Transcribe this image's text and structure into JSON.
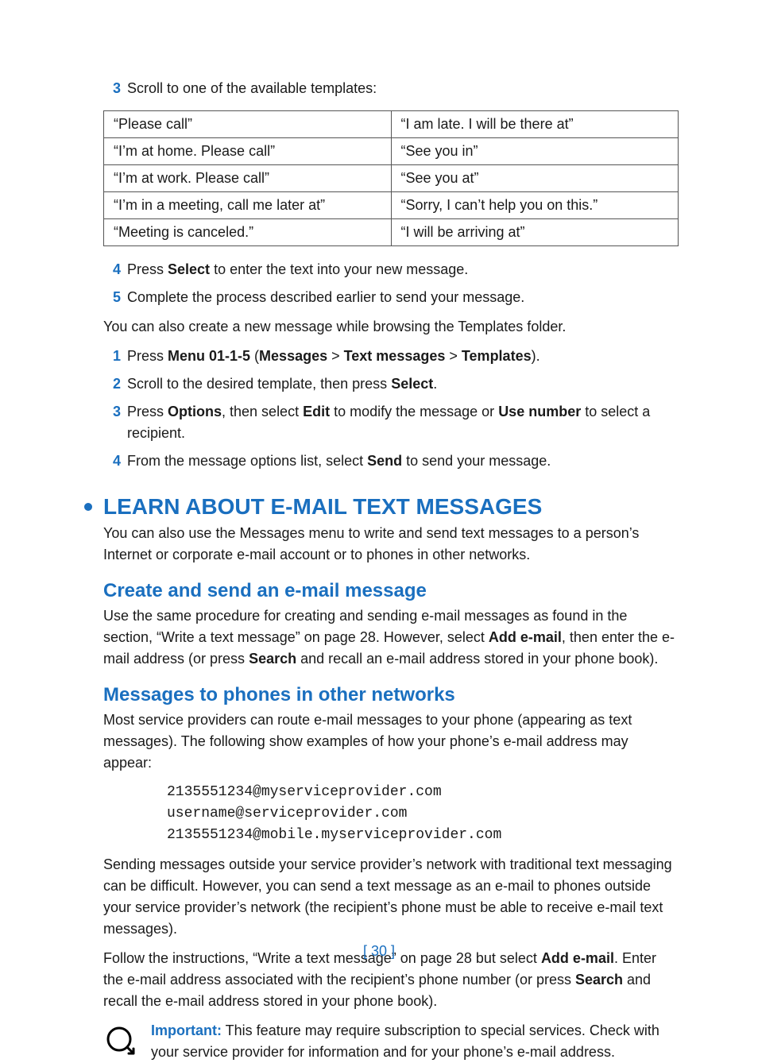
{
  "steps_a": [
    {
      "n": "3",
      "text": "Scroll to one of the available templates:"
    }
  ],
  "templates": [
    [
      "“Please call”",
      "“I am late. I will be there at”"
    ],
    [
      "“I’m at home. Please call”",
      "“See you in”"
    ],
    [
      "“I’m at work. Please call”",
      "“See you at”"
    ],
    [
      "“I’m in a meeting, call me later at”",
      "“Sorry, I can’t help you on this.”"
    ],
    [
      "“Meeting is canceled.”",
      "“I will be arriving at”"
    ]
  ],
  "steps_b": [
    {
      "n": "4",
      "html": "Press <b>Select</b> to enter the text into your new message."
    },
    {
      "n": "5",
      "html": "Complete the process described earlier to send your message."
    }
  ],
  "mid_para": "You can also create a new message while browsing the Templates folder.",
  "steps_c": [
    {
      "n": "1",
      "html": "Press <b>Menu 01-1-5</b> (<b>Messages</b> &gt; <b>Text messages</b> &gt; <b>Templates</b>)."
    },
    {
      "n": "2",
      "html": "Scroll to the desired template, then press <b>Select</b>."
    },
    {
      "n": "3",
      "html": "Press <b>Options</b>, then select <b>Edit</b> to modify the message or <b>Use number</b> to select a recipient."
    },
    {
      "n": "4",
      "html": "From the message options list, select <b>Send</b> to send your message."
    }
  ],
  "h1": "LEARN ABOUT E-MAIL TEXT MESSAGES",
  "h1_para": "You can also use the Messages menu to write and send text messages to a person’s Internet or corporate e-mail account or to phones in other networks.",
  "h2a": "Create and send an e-mail message",
  "h2a_para": "Use the same procedure for creating and sending e-mail messages as found in the section, “Write a text message” on page 28. However, select <b>Add e-mail</b>, then enter the e-mail address (or press <b>Search</b> and recall an e-mail address stored in your phone book).",
  "h2b": "Messages to phones in other networks",
  "h2b_para1": "Most service providers can route e-mail messages to your phone (appearing as text messages). The following show examples of how your phone’s e-mail address may appear:",
  "examples": "2135551234@myserviceprovider.com\nusername@serviceprovider.com\n2135551234@mobile.myserviceprovider.com",
  "h2b_para2": "Sending messages outside your service provider’s network with traditional text messaging can be difficult. However, you can send a text message as an e-mail to phones outside your service provider’s network (the recipient’s phone must be able to receive e-mail text messages).",
  "h2b_para3": "Follow the instructions, “Write a text message” on page 28 but select <b>Add e-mail</b>. Enter the e-mail address associated with the recipient’s phone number (or press <b>Search</b> and recall the e-mail address stored in your phone book).",
  "important_label": "Important:",
  "important_text": " This feature may require subscription to special services. Check with your service provider for information and for your phone’s e-mail address.",
  "page_number": "[ 30 ]"
}
